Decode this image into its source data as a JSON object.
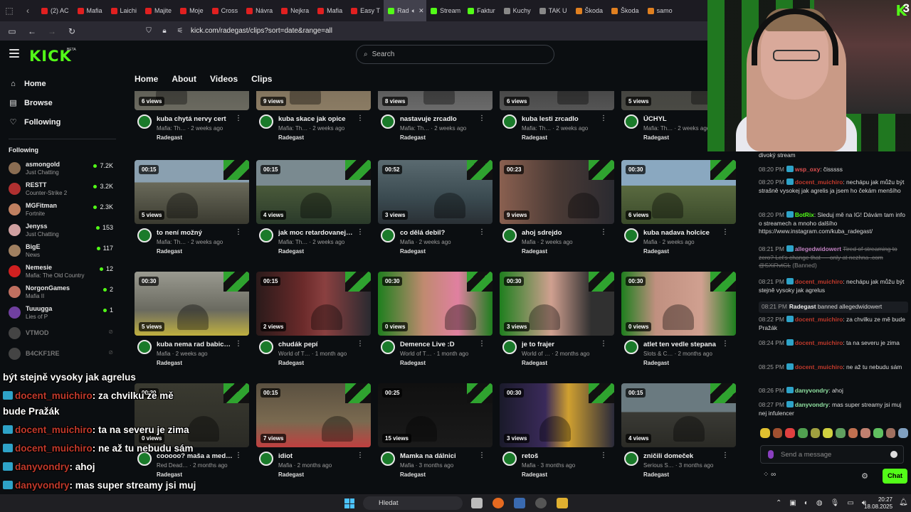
{
  "browser": {
    "tabs": [
      {
        "label": "(2) AC",
        "color": "#e02020"
      },
      {
        "label": "Mafia",
        "color": "#e02020"
      },
      {
        "label": "Laichi",
        "color": "#e02020"
      },
      {
        "label": "Majite",
        "color": "#e02020"
      },
      {
        "label": "Moje",
        "color": "#e02020"
      },
      {
        "label": "Cross",
        "color": "#e02020"
      },
      {
        "label": "Návra",
        "color": "#e02020"
      },
      {
        "label": "Nejkra",
        "color": "#e02020"
      },
      {
        "label": "Mafia",
        "color": "#e02020"
      },
      {
        "label": "Easy T",
        "color": "#e02020"
      },
      {
        "label": "Rad",
        "color": "#53fc18",
        "active": true
      },
      {
        "label": "Stream",
        "color": "#53fc18"
      },
      {
        "label": "Faktur",
        "color": "#53fc18"
      },
      {
        "label": "Kuchy",
        "color": "#888888"
      },
      {
        "label": "TAK U",
        "color": "#888888"
      },
      {
        "label": "Škoda",
        "color": "#e08020"
      },
      {
        "label": "Škoda",
        "color": "#e08020"
      },
      {
        "label": "samo",
        "color": "#e08020"
      }
    ],
    "url": "kick.com/radegast/clips?sort=date&range=all"
  },
  "header": {
    "logo": "KICK",
    "beta": "BETA",
    "search_placeholder": "Search"
  },
  "sidebar": {
    "nav": [
      {
        "label": "Home",
        "icon": "home-icon",
        "glyph": "⌂"
      },
      {
        "label": "Browse",
        "icon": "browse-icon",
        "glyph": "▤"
      },
      {
        "label": "Following",
        "icon": "heart-icon",
        "glyph": "♡"
      }
    ],
    "following_title": "Following",
    "following": [
      {
        "name": "asmongold",
        "sub": "Just Chatting",
        "viewers": "7.2K",
        "color": "#8a6d52"
      },
      {
        "name": "RESTT",
        "sub": "Counter-Strike 2",
        "viewers": "3.2K",
        "color": "#b03030"
      },
      {
        "name": "MGFitman",
        "sub": "Fortnite",
        "viewers": "2.3K",
        "color": "#c08060"
      },
      {
        "name": "Jenyss",
        "sub": "Just Chatting",
        "viewers": "153",
        "color": "#d0a0a0"
      },
      {
        "name": "BigE",
        "sub": "News",
        "viewers": "117",
        "color": "#a08060"
      },
      {
        "name": "Nemesie",
        "sub": "Mafia: The Old Country",
        "viewers": "12",
        "color": "#d02020"
      },
      {
        "name": "NorgonGames",
        "sub": "Mafia II",
        "viewers": "2",
        "color": "#c07060"
      },
      {
        "name": "Tuuugga",
        "sub": "Lies of P",
        "viewers": "1",
        "color": "#7040a0"
      },
      {
        "name": "VTMOD",
        "sub": "",
        "viewers": "",
        "color": "#444444",
        "offline": true
      },
      {
        "name": "B4CKF1RE",
        "sub": "",
        "viewers": "",
        "color": "#444444",
        "offline": true
      }
    ]
  },
  "channel_tabs": [
    "Home",
    "About",
    "Videos",
    "Clips"
  ],
  "clips": [
    {
      "duration": "",
      "views": "6 views",
      "title": "kuba chytá nervy cert",
      "sub": "Mafia: Th… · 2 weeks ago",
      "channel": "Radegast",
      "bg": "linear-gradient(180deg,#4a4a44,#6b6a60)"
    },
    {
      "duration": "",
      "views": "9 views",
      "title": "kuba skace jak opice",
      "sub": "Mafia: Th… · 2 weeks ago",
      "channel": "Radegast",
      "bg": "linear-gradient(180deg,#6d6150,#8b7c64)"
    },
    {
      "duration": "",
      "views": "8 views",
      "title": "nastavuje zrcadlo",
      "sub": "Mafia: Th… · 2 weeks ago",
      "channel": "Radegast",
      "bg": "linear-gradient(180deg,#3a3a3a,#6b6b6b)"
    },
    {
      "duration": "",
      "views": "6 views",
      "title": "kuba lesti zrcadlo",
      "sub": "Mafia: Th… · 2 weeks ago",
      "channel": "Radegast",
      "bg": "linear-gradient(180deg,#2a2a2a,#555555)"
    },
    {
      "duration": "",
      "views": "5 views",
      "title": "ÚCHYL",
      "sub": "Mafia: Th… · 2 weeks ago",
      "channel": "Radegast",
      "bg": "linear-gradient(180deg,#3a3a3a,#4a4a44)"
    },
    {
      "duration": "00:15",
      "views": "5 views",
      "title": "to není možný",
      "sub": "Mafia: Th… · 2 weeks ago",
      "channel": "Radegast",
      "bg": "linear-gradient(180deg,#8aa0b0 0 35%,#6a6a5a 35%,#3a3a30)"
    },
    {
      "duration": "00:15",
      "views": "4 views",
      "title": "jak moc retardovanej…",
      "sub": "Mafia: Th… · 2 weeks ago",
      "channel": "Radegast",
      "bg": "linear-gradient(180deg,#7a8a90 0 40%,#4a5a3a 40%,#2a3a2a)"
    },
    {
      "duration": "00:52",
      "views": "3 views",
      "title": "co dělá debil?",
      "sub": "Mafia · 2 weeks ago",
      "channel": "Radegast",
      "bg": "linear-gradient(180deg,#5a6a70,#3a4a50 60%,#2a3035)"
    },
    {
      "duration": "00:23",
      "views": "9 views",
      "title": "ahoj sdrejdo",
      "sub": "Mafia · 2 weeks ago",
      "channel": "Radegast",
      "bg": "linear-gradient(90deg,#8a6050,#4a3a35 50%,#2a2a30)"
    },
    {
      "duration": "00:30",
      "views": "6 views",
      "title": "kuba nadava holcice",
      "sub": "Mafia · 2 weeks ago",
      "channel": "Radegast",
      "bg": "linear-gradient(180deg,#8aa8c0 0 40%,#5a6a40 40%,#3a4a2a)"
    },
    {
      "duration": "00:30",
      "views": "5 views",
      "title": "kuba nema rad babic…",
      "sub": "Mafia · 2 weeks ago",
      "channel": "Radegast",
      "bg": "linear-gradient(180deg,#9a9a90,#6a6a60 60%,#c0b040)"
    },
    {
      "duration": "00:15",
      "views": "2 views",
      "title": "chudák pepí",
      "sub": "World of T… · 1 month ago",
      "channel": "Radegast",
      "bg": "linear-gradient(90deg,#2a1a1a,#6a2a2a 40%,#8a4040 60%,#2a2a30)"
    },
    {
      "duration": "00:30",
      "views": "0 views",
      "title": "Demence Live :D",
      "sub": "World of T… · 1 month ago",
      "channel": "Radegast",
      "bg": "linear-gradient(90deg,#1e7f1e,#c08a70 40%,#e080a0 70%,#1e7f1e)"
    },
    {
      "duration": "00:30",
      "views": "3 views",
      "title": "je to frajer",
      "sub": "World of … · 2 months ago",
      "channel": "Radegast",
      "bg": "linear-gradient(90deg,#1e7f1e,#d0a090 45%,#303030 80%)"
    },
    {
      "duration": "00:30",
      "views": "0 views",
      "title": "atlet ten vedle stepana",
      "sub": "Slots & C… · 2 months ago",
      "channel": "Radegast",
      "bg": "linear-gradient(90deg,#1e7f1e,#c09080 30%,#d0a090 70%,#1e7f1e)"
    },
    {
      "duration": "00:30",
      "views": "0 views",
      "title": "cooooo? maša a med…",
      "sub": "Red Dead… · 2 months ago",
      "channel": "Radegast",
      "bg": "linear-gradient(180deg,#3a3a30,#2a2a25)"
    },
    {
      "duration": "00:15",
      "views": "7 views",
      "title": "idiot",
      "sub": "Mafia · 2 months ago",
      "channel": "Radegast",
      "bg": "linear-gradient(180deg,#5a5040,#7a6a50 60%,#c04040)"
    },
    {
      "duration": "00:25",
      "views": "15 views",
      "title": "Mamka na dálnici",
      "sub": "Mafia · 3 months ago",
      "channel": "Radegast",
      "bg": "linear-gradient(180deg,#101010,#1a1a1a)"
    },
    {
      "duration": "00:30",
      "views": "3 views",
      "title": "retoš",
      "sub": "Mafia · 3 months ago",
      "channel": "Radegast",
      "bg": "linear-gradient(90deg,#1a1a2a,#3a2a5a 40%,#d0a030 60%,#2a2a3a)"
    },
    {
      "duration": "00:15",
      "views": "4 views",
      "title": "zničili domeček",
      "sub": "Serious S… · 3 months ago",
      "channel": "Radegast",
      "bg": "linear-gradient(180deg,#6a7a80 0 45%,#3a3a35 45%,#2a2a25)"
    }
  ],
  "webcam": {
    "logo": "K",
    "number": "3"
  },
  "chat": {
    "messages": [
      {
        "time": "",
        "user": "",
        "text": "divoký stream",
        "color": "#dcdcdc"
      },
      {
        "time": "08:20 PM",
        "user": "wsp_oxy",
        "text": "čisssss",
        "color": "#e05050"
      },
      {
        "time": "08:20 PM",
        "user": "docent_muichiro",
        "text": "nechápu jak můžu být strašně vysokej jak agrelis ja jsem ho čekám menšího",
        "color": "#c0392b"
      },
      {
        "time": "08:20 PM",
        "user": "BotRix",
        "text": "Sleduj mě na IG! Dávám tam info o streamech a mnoho dalšího https://www.instagram.com/kuba_radegast/",
        "color": "#53fc18"
      },
      {
        "time": "08:21 PM",
        "user": "allegedwidowert",
        "text": "Tired of streaming to zero? Let's change that — only at nezhna .com @SXiRvtGL",
        "flag": "(Banned)",
        "color": "#c080c0",
        "deleted": true
      },
      {
        "time": "08:21 PM",
        "user": "docent_muichiro",
        "text": "nechápu jak můžu být stejně vysoky jak agrelus",
        "color": "#c0392b"
      },
      {
        "time": "08:21 PM",
        "user": "Radegast",
        "text": "banned allegedwidowert",
        "color": "#f0f0f0",
        "system": true
      },
      {
        "time": "08:22 PM",
        "user": "docent_muichiro",
        "text": "za chvilku ze mě bude Pražák",
        "color": "#c0392b"
      },
      {
        "time": "08:24 PM",
        "user": "docent_muichiro",
        "text": "ta na severu je zima",
        "color": "#c0392b"
      },
      {
        "time": "08:25 PM",
        "user": "docent_muichiro",
        "text": "ne až tu nebudu sám",
        "color": "#c0392b"
      },
      {
        "time": "08:26 PM",
        "user": "danyvondry",
        "text": "ahoj",
        "color": "#8fe0a0"
      },
      {
        "time": "08:27 PM",
        "user": "danyvondry",
        "text": "mas super streamy jsi muj nej infulencer",
        "color": "#8fe0a0"
      }
    ],
    "input_placeholder": "Send a message",
    "send_label": "Chat",
    "emote_colors": [
      "#e0c030",
      "#a05030",
      "#e04040",
      "#50a050",
      "#a0a040",
      "#d0d040",
      "#60a060",
      "#c07050",
      "#c08070",
      "#60c060",
      "#a07060",
      "#80a0c0"
    ]
  },
  "overlay": [
    {
      "user": "",
      "text": "být stejně vysoky jak agrelus"
    },
    {
      "user": "docent_muichiro",
      "text": ": za chvilku ze mě"
    },
    {
      "user": "",
      "text": "bude Pražák"
    },
    {
      "user": "docent_muichiro",
      "text": ": ta na severu je zima"
    },
    {
      "user": "docent_muichiro",
      "text": ": ne až tu nebudu sám"
    },
    {
      "user": "danyvondry",
      "text": ": ahoj"
    },
    {
      "user": "danyvondry",
      "text": ": mas super streamy jsi muj"
    },
    {
      "user": "",
      "text": "nej infulencer"
    }
  ],
  "taskbar": {
    "search_placeholder": "Hledat",
    "time": "20:27",
    "date": "18.08.2025"
  }
}
